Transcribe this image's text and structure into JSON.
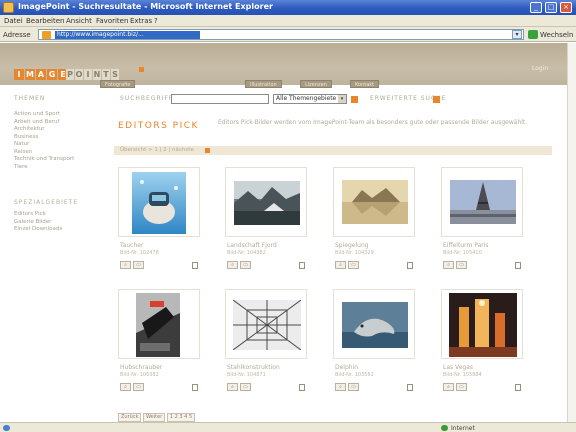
{
  "window": {
    "title": "ImagePoint - Suchresultate - Microsoft Internet Explorer"
  },
  "menubar": [
    "Datei",
    "Bearbeiten",
    "Ansicht",
    "Favoriten",
    "Extras",
    "?"
  ],
  "address": {
    "label": "Adresse",
    "url": "http://www.imagepoint.biz/...",
    "go_label": "Wechseln zu"
  },
  "site": {
    "logo_highlight": [
      "I",
      "M",
      "A",
      "G",
      "E"
    ],
    "logo_rest": [
      "P",
      "O",
      "I",
      "N",
      "T",
      "S"
    ],
    "header_right": "Login",
    "nav_tabs": [
      "Fotografie",
      "Illustration",
      "Lizenzen",
      "Kontakt"
    ]
  },
  "search": {
    "left_title": "THEMEN",
    "label": "SUCHBEGRIFF",
    "select_value": "Alle Themengebiete",
    "adv_label": "ERWEITERTE SUCHE"
  },
  "sidebar": {
    "items": [
      "Action und Sport",
      "Arbeit und Beruf",
      "Architektur",
      "Business",
      "Natur",
      "Reisen",
      "Technik und Transport",
      "Tiere"
    ],
    "section2_title": "SPEZIALGEBIETE",
    "items2": [
      "Editors Pick",
      "Galerie Bilder",
      "Einzel Downloads"
    ]
  },
  "content": {
    "title": "EDITORS PICK",
    "description": "Editors Pick-Bilder werden vom ImagePoint-Team als besonders gute oder passende Bilder ausgewählt.",
    "crumb": "Übersicht > 1 | 2 | nächste"
  },
  "thumbs": [
    {
      "title": "Taucher",
      "meta": "Bild-Nr. 102478"
    },
    {
      "title": "Landschaft Fjord",
      "meta": "Bild-Nr. 104382"
    },
    {
      "title": "Spiegelung",
      "meta": "Bild-Nr. 104329"
    },
    {
      "title": "Eiffelturm Paris",
      "meta": "Bild-Nr. 105410"
    },
    {
      "title": "Hubschrauber",
      "meta": "Bild-Nr. 106382"
    },
    {
      "title": "Stahlkonstruktion",
      "meta": "Bild-Nr. 104871"
    },
    {
      "title": "Delphin",
      "meta": "Bild-Nr. 103582"
    },
    {
      "title": "Las Vegas",
      "meta": "Bild-Nr. 105884"
    }
  ],
  "icon_labels": {
    "lupe": "⌕",
    "korb": "▭"
  },
  "pager": {
    "prev": "Zurück",
    "next": "Weiter",
    "pages": "1 2 3 4 5"
  },
  "status": {
    "zone": "Internet"
  },
  "colors": {
    "accent": "#e7862c",
    "titlebar": "#2d5bc0",
    "header": "#c7bda8"
  }
}
